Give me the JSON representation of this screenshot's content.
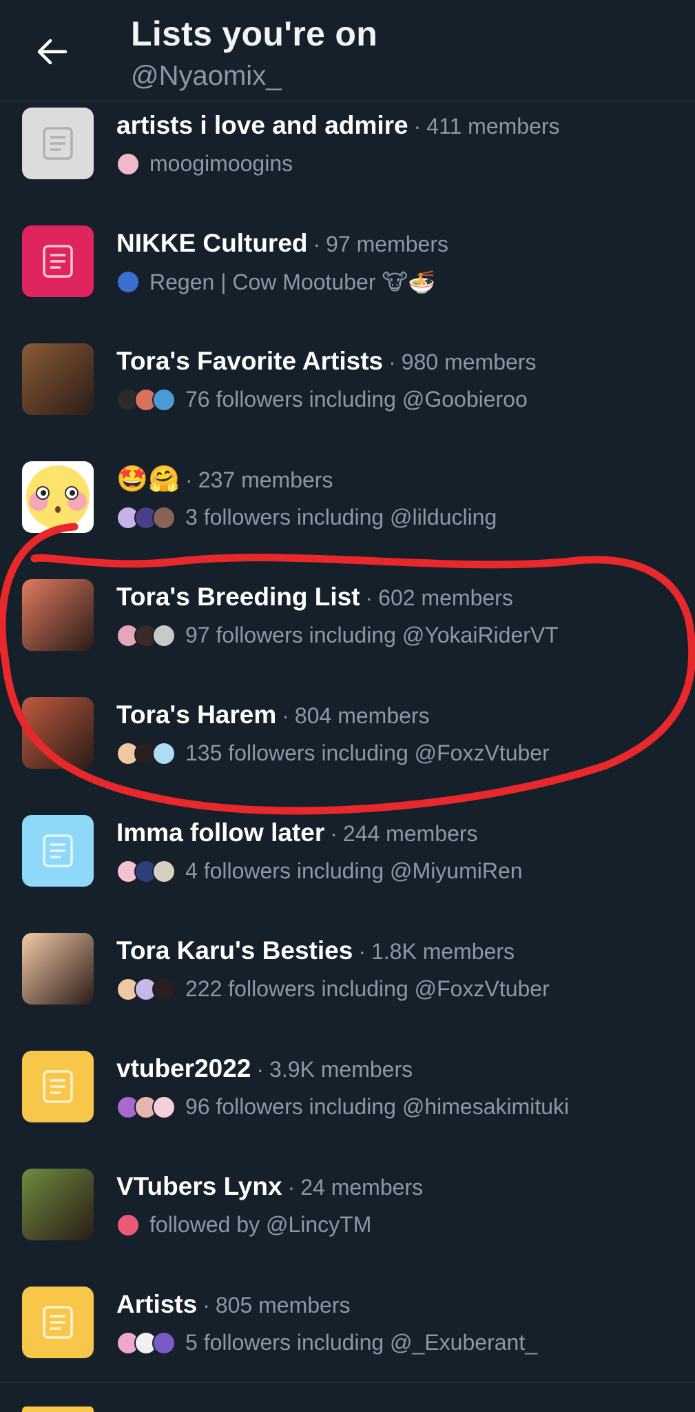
{
  "header": {
    "title": "Lists you're on",
    "handle": "@Nyaomix_"
  },
  "colors": {
    "background": "#15202b",
    "secondary_text": "#8b98a5",
    "annotation_red": "#e8282b"
  },
  "separator": "·",
  "lists": [
    {
      "name": "artists i love and admire",
      "members": "411 members",
      "owner_or_followers": "moogimoogins",
      "thumb_color": "#dcdcdc",
      "thumb_type": "list-icon",
      "avatars": [
        "#f2b9c8"
      ]
    },
    {
      "name": "NIKKE Cultured",
      "members": "97 members",
      "owner_or_followers": "Regen | Cow Mootuber 🐮🍜",
      "thumb_color": "#e0245e",
      "thumb_type": "list-icon",
      "avatars": [
        "#3a6fd1"
      ]
    },
    {
      "name": "Tora's Favorite Artists",
      "members": "980 members",
      "owner_or_followers": "76 followers including @Goobieroo",
      "thumb_color": "#8a5a34",
      "thumb_type": "image",
      "avatars": [
        "#2b2b2b",
        "#d8705a",
        "#4d9bd6"
      ]
    },
    {
      "name": "🤩🤗",
      "members": "237 members",
      "owner_or_followers": "3 followers including @lilducling",
      "thumb_color": "#ffffff",
      "thumb_type": "emoji-face",
      "avatars": [
        "#c7b2e8",
        "#4b3f8a",
        "#8a6258"
      ]
    },
    {
      "name": "Tora's Breeding List",
      "members": "602 members",
      "owner_or_followers": "97 followers including @YokaiRiderVT",
      "thumb_color": "#e07a5f",
      "thumb_type": "image",
      "avatars": [
        "#e7a6b8",
        "#3c2a2a",
        "#c9c9c9"
      ]
    },
    {
      "name": "Tora's Harem",
      "members": "804 members",
      "owner_or_followers": "135 followers including @FoxzVtuber",
      "thumb_color": "#c05a3e",
      "thumb_type": "image",
      "avatars": [
        "#f0c8a0",
        "#2a1f1f",
        "#aedcf2"
      ]
    },
    {
      "name": "Imma follow later",
      "members": "244 members",
      "owner_or_followers": "4 followers including @MiyumiRen",
      "thumb_color": "#8ed8f8",
      "thumb_type": "list-icon",
      "avatars": [
        "#f2c2d0",
        "#2f3d7a",
        "#d6d0c0"
      ]
    },
    {
      "name": "Tora Karu's Besties",
      "members": "1.8K members",
      "owner_or_followers": "222 followers including @FoxzVtuber",
      "thumb_color": "#f3c9a6",
      "thumb_type": "image",
      "avatars": [
        "#f0c8a0",
        "#c8b8e8",
        "#2a1f1f"
      ]
    },
    {
      "name": "vtuber2022",
      "members": "3.9K members",
      "owner_or_followers": "96 followers including @himesakimituki",
      "thumb_color": "#f8c74a",
      "thumb_type": "list-icon",
      "avatars": [
        "#a86ad0",
        "#e8b4b0",
        "#f5d0d8"
      ]
    },
    {
      "name": "VTubers Lynx",
      "members": "24 members",
      "owner_or_followers": "followed by @LincyTM",
      "thumb_color": "#6f8c3e",
      "thumb_type": "image",
      "avatars": [
        "#e85a78"
      ]
    },
    {
      "name": "Artists",
      "members": "805 members",
      "owner_or_followers": "5 followers including @_Exuberant_",
      "thumb_color": "#f8c74a",
      "thumb_type": "list-icon",
      "avatars": [
        "#f2a6d0",
        "#f0f0f0",
        "#7a5ac8"
      ]
    }
  ]
}
